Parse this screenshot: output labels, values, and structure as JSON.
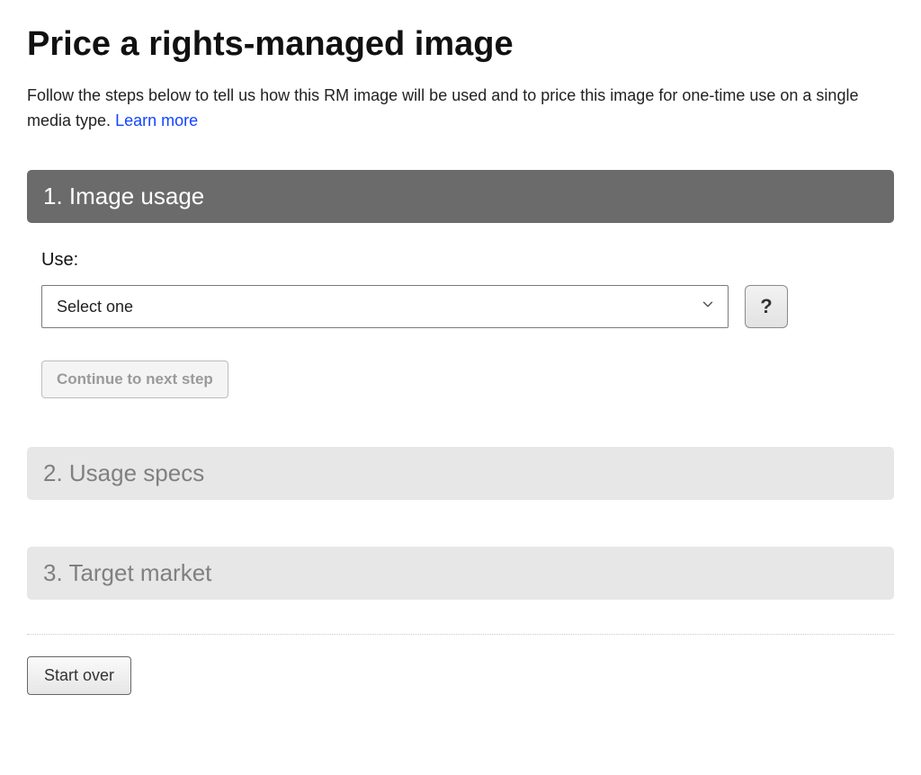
{
  "title": "Price a rights-managed image",
  "intro_text": "Follow the steps below to tell us how this RM image will be used and to price this image for one-time use on a single media type. ",
  "learn_more": "Learn more",
  "steps": {
    "s1": {
      "header": "1. Image usage"
    },
    "s2": {
      "header": "2. Usage specs"
    },
    "s3": {
      "header": "3. Target market"
    }
  },
  "form": {
    "use_label": "Use:",
    "use_placeholder": "Select one",
    "help_label": "?",
    "continue_label": "Continue to next step"
  },
  "actions": {
    "start_over": "Start over"
  }
}
